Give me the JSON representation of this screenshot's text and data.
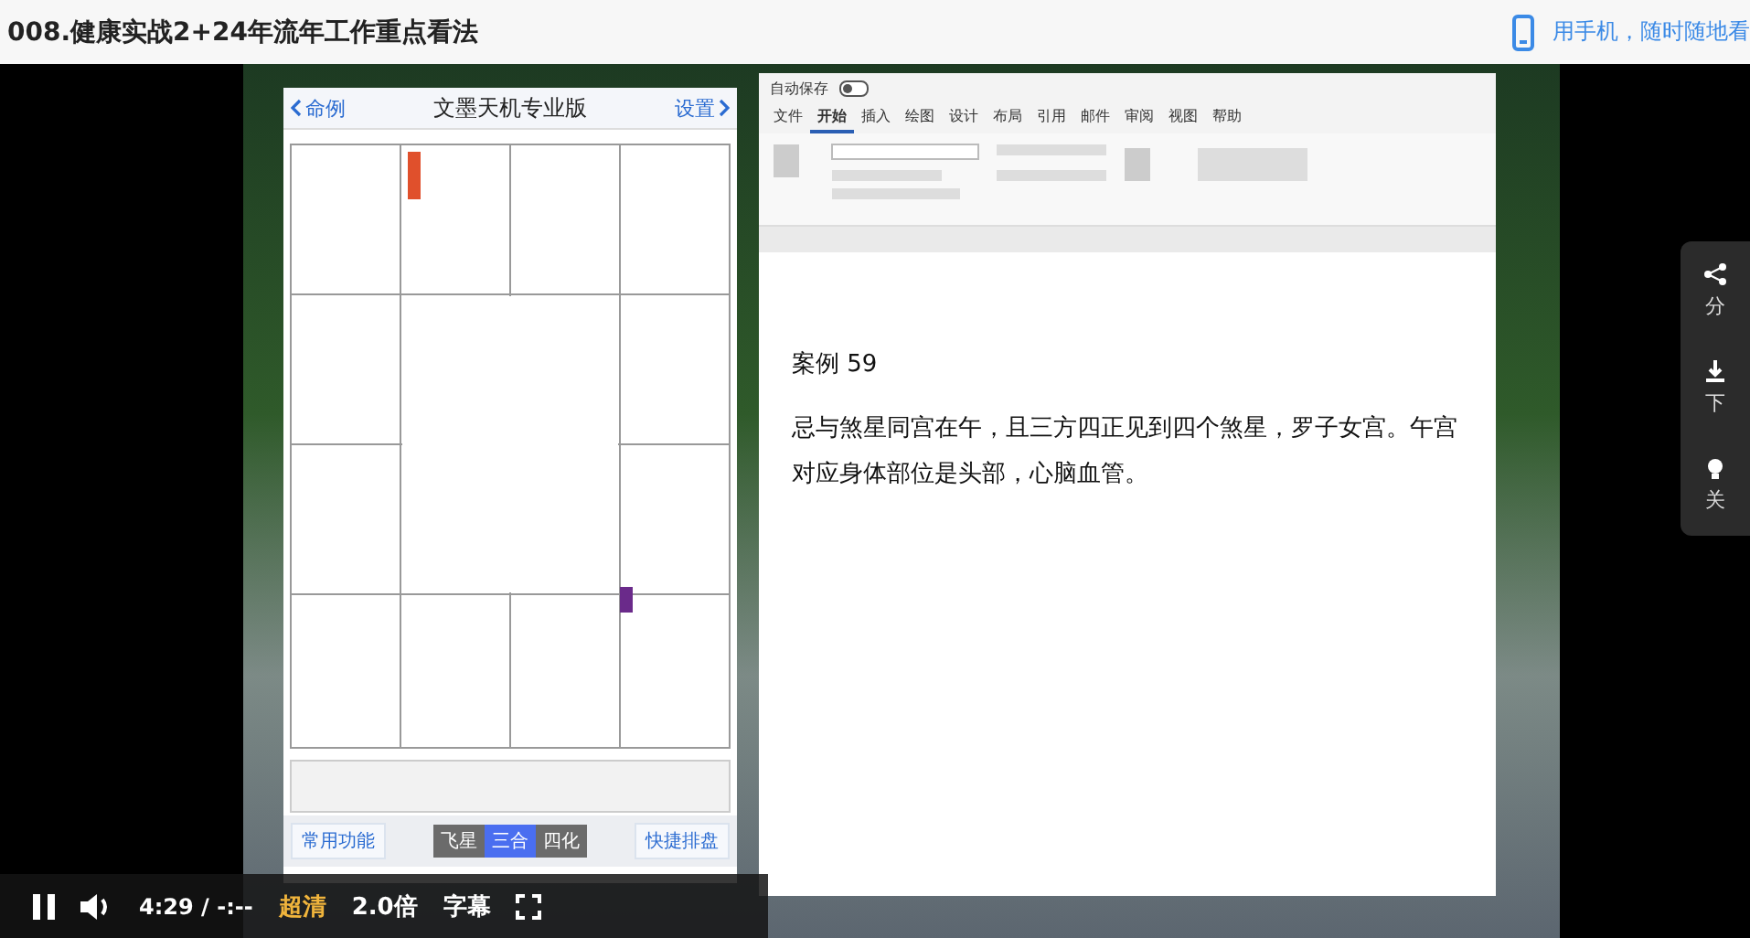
{
  "page": {
    "title": "008.健康实战2+24年流年工作重点看法",
    "mobile_link": "用手机，随时随地看"
  },
  "phone_app": {
    "back": "命例",
    "title": "文墨天机专业版",
    "settings": "设置",
    "buttons": [
      "常用功能",
      "快捷排盘"
    ],
    "modes": [
      {
        "label": "飞星",
        "selected": false
      },
      {
        "label": "三合",
        "selected": true
      },
      {
        "label": "四化",
        "selected": false
      }
    ]
  },
  "word": {
    "autosave": "自动保存",
    "autosave_on": false,
    "tabs": [
      {
        "label": "文件",
        "selected": false
      },
      {
        "label": "开始",
        "selected": true
      },
      {
        "label": "插入",
        "selected": false
      },
      {
        "label": "绘图",
        "selected": false
      },
      {
        "label": "设计",
        "selected": false
      },
      {
        "label": "布局",
        "selected": false
      },
      {
        "label": "引用",
        "selected": false
      },
      {
        "label": "邮件",
        "selected": false
      },
      {
        "label": "审阅",
        "selected": false
      },
      {
        "label": "视图",
        "selected": false
      },
      {
        "label": "帮助",
        "selected": false
      }
    ],
    "heading": "案例 59",
    "paragraph": "忌与煞星同宫在午，且三方四正见到四个煞星，罗子女宫。午宫对应身体部位是头部，心脑血管。"
  },
  "side_panel": [
    "分",
    "下",
    "关"
  ],
  "player": {
    "time": "4:29 / -:--",
    "quality": "超清",
    "speed": "2.0倍",
    "subtitles": "字幕"
  }
}
